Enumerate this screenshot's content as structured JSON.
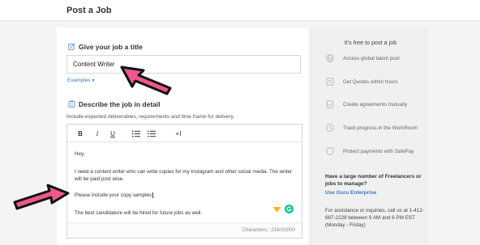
{
  "header": {
    "title": "Post a Job"
  },
  "title_section": {
    "label": "Give your job a title",
    "value": "Content Writer",
    "examples_label": "Examples",
    "icon": "edit-icon"
  },
  "description_section": {
    "label": "Describe the job in detail",
    "hint": "Include expected deliverables, requirements and time frame for delivery.",
    "icon": "clipboard-icon"
  },
  "editor": {
    "toolbar": {
      "bold": "B",
      "italic": "I",
      "underline": "U",
      "insert": "+I"
    },
    "lines": [
      "Hey,",
      "I need a content writer who can write copies for my Instagram and other social media. The writer will be paid post wise.",
      "Please include your copy samples",
      "The best candidature will be hired for future jobs as well."
    ],
    "characters": "Characters : 216/10000"
  },
  "sidebar": {
    "heading": "It's free to post a job",
    "features": [
      {
        "label": "Access global talent pool",
        "icon": "globe-icon"
      },
      {
        "label": "Get Quotes within hours",
        "icon": "quote-icon"
      },
      {
        "label": "Create agreements mutually",
        "icon": "agreement-icon"
      },
      {
        "label": "Track progress in the WorkRoom",
        "icon": "clock-icon"
      },
      {
        "label": "Protect payments with SafePay",
        "icon": "shield-icon"
      }
    ],
    "enterprise_question": "Have a large number of Freelancers or jobs to manage?",
    "enterprise_link": "Use Guru Enterprise",
    "help_text": "For assistance or inquiries, call us at 1-412-687-2228 between 9 AM and 6 PM EST (Monday - Friday)"
  },
  "colors": {
    "accent_link": "#3a78c3",
    "arrow_fill": "#f0568f",
    "arrow_outline": "#111111",
    "grammarly": "#15c39a",
    "emoji_tool": "#f6b40e"
  }
}
